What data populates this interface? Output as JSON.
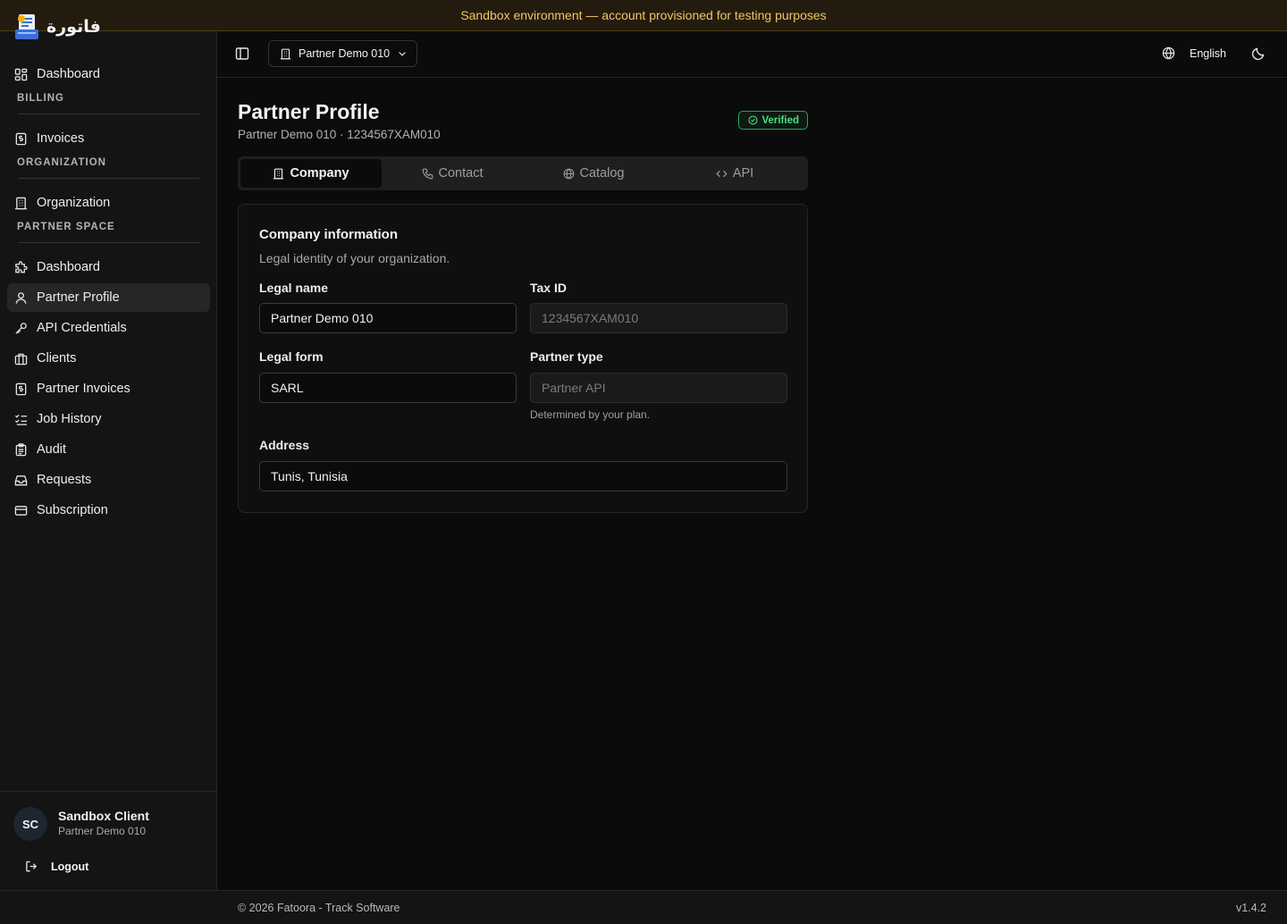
{
  "banner": {
    "text": "Sandbox environment — account provisioned for testing purposes"
  },
  "brand": {
    "name": "فاتورة"
  },
  "sidebar": {
    "items_top": [
      {
        "label": "Dashboard",
        "icon": "grid-icon"
      }
    ],
    "billing_label": "BILLING",
    "billing_items": [
      {
        "label": "Invoices",
        "icon": "invoice-icon"
      }
    ],
    "organization_label": "ORGANIZATION",
    "organization_items": [
      {
        "label": "Organization",
        "icon": "building-icon"
      }
    ],
    "partner_label": "PARTNER SPACE",
    "partner_items": [
      {
        "label": "Dashboard",
        "icon": "puzzle-icon"
      },
      {
        "label": "Partner Profile",
        "icon": "user-icon",
        "active": true
      },
      {
        "label": "API Credentials",
        "icon": "key-icon"
      },
      {
        "label": "Clients",
        "icon": "briefcase-icon"
      },
      {
        "label": "Partner Invoices",
        "icon": "invoice-icon"
      },
      {
        "label": "Job History",
        "icon": "checklist-icon"
      },
      {
        "label": "Audit",
        "icon": "clipboard-icon"
      },
      {
        "label": "Requests",
        "icon": "inbox-icon"
      },
      {
        "label": "Subscription",
        "icon": "card-icon"
      }
    ]
  },
  "user": {
    "initials": "SC",
    "name": "Sandbox Client",
    "org": "Partner Demo 010",
    "logout": "Logout"
  },
  "topbar": {
    "org_selector": "Partner Demo 010",
    "language": "English"
  },
  "page": {
    "title": "Partner Profile",
    "subtitle": "Partner Demo 010 · 1234567XAM010",
    "badge": "Verified",
    "tabs": [
      {
        "label": "Company",
        "icon": "building-icon",
        "active": true
      },
      {
        "label": "Contact",
        "icon": "phone-icon"
      },
      {
        "label": "Catalog",
        "icon": "globe-icon"
      },
      {
        "label": "API",
        "icon": "code-icon"
      }
    ]
  },
  "form": {
    "title": "Company information",
    "description": "Legal identity of your organization.",
    "legal_name_label": "Legal name",
    "legal_name_value": "Partner Demo 010",
    "tax_id_label": "Tax ID",
    "tax_id_value": "1234567XAM010",
    "legal_form_label": "Legal form",
    "legal_form_value": "SARL",
    "partner_type_label": "Partner type",
    "partner_type_value": "Partner API",
    "partner_type_hint": "Determined by your plan.",
    "address_label": "Address",
    "address_value": "Tunis, Tunisia"
  },
  "footer": {
    "copyright": "© 2026 Fatoora - Track Software",
    "version": "v1.4.2"
  },
  "colors": {
    "accent_success": "#4ade80",
    "banner_text": "#f0c566",
    "background": "#0b0b0b"
  }
}
